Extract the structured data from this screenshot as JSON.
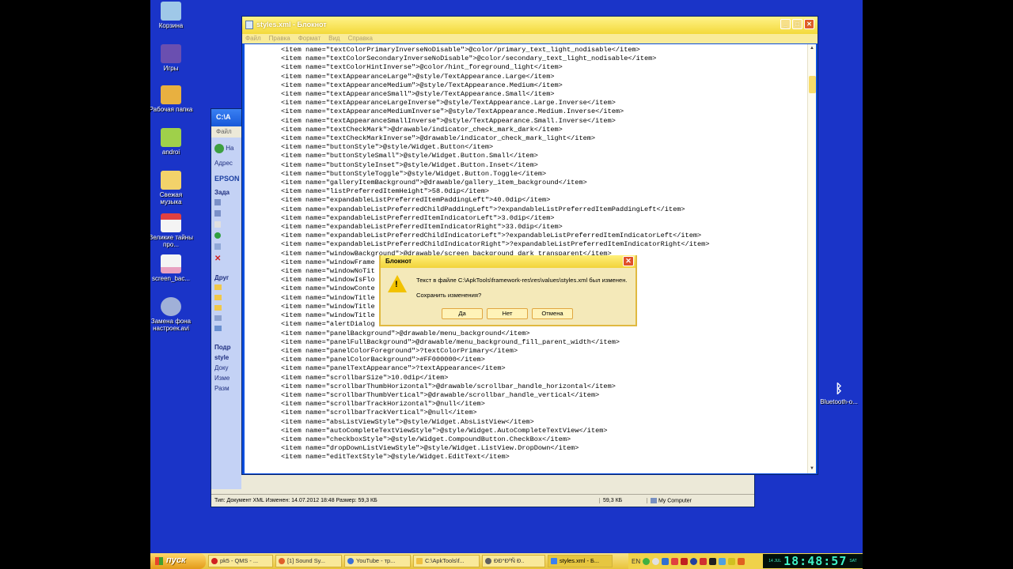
{
  "desktop": {
    "icons": [
      {
        "label": "Корзина",
        "icon": "recycle-bin-icon",
        "color": "#9fc8e8"
      },
      {
        "label": "Игры",
        "icon": "games-icon",
        "color": "#6a4fb0"
      },
      {
        "label": "Рабочая папка",
        "icon": "tools-folder-icon",
        "color": "#e8b040"
      },
      {
        "label": "androi",
        "icon": "android-icon",
        "color": "#9fd04a"
      },
      {
        "label": "Свежая музыка",
        "icon": "folder-icon",
        "color": "#f3d26a"
      },
      {
        "label": "Великие тайны про...",
        "icon": "pdf-icon",
        "color": "#e04040"
      },
      {
        "label": "screen_bac...",
        "icon": "image-file-icon",
        "color": "#e8a0c0"
      },
      {
        "label": "Замена фона настроек.avi",
        "icon": "video-file-icon",
        "color": "#a0b0d8"
      }
    ],
    "bluetooth_label": "Bluetooth-о..."
  },
  "explorer": {
    "title": "C:\\A",
    "menu": "Файл",
    "back_label": "На",
    "address_label": "Адрес",
    "folder_label": "EPSON",
    "tasks_head": "Зада",
    "other_head": "Друг",
    "details_head": "Подр",
    "details_name": "style",
    "details_type": "Доку",
    "details_changed": "Изме",
    "details_size": "Разм",
    "status_left": "Тип: Документ XML Изменен: 14.07.2012 18:48 Размер: 59,3 КБ",
    "status_size": "59,3 КБ",
    "status_location": "My Computer"
  },
  "notepad": {
    "title": "styles.xml - Блокнот",
    "menu": [
      "Файл",
      "Правка",
      "Формат",
      "Вид",
      "Справка"
    ],
    "lines": [
      "<item name=\"textColorPrimaryInverseNoDisable\">@color/primary_text_light_nodisable</item>",
      "<item name=\"textColorSecondaryInverseNoDisable\">@color/secondary_text_light_nodisable</item>",
      "<item name=\"textColorHintInverse\">@color/hint_foreground_light</item>",
      "<item name=\"textAppearanceLarge\">@style/TextAppearance.Large</item>",
      "<item name=\"textAppearanceMedium\">@style/TextAppearance.Medium</item>",
      "<item name=\"textAppearanceSmall\">@style/TextAppearance.Small</item>",
      "<item name=\"textAppearanceLargeInverse\">@style/TextAppearance.Large.Inverse</item>",
      "<item name=\"textAppearanceMediumInverse\">@style/TextAppearance.Medium.Inverse</item>",
      "<item name=\"textAppearanceSmallInverse\">@style/TextAppearance.Small.Inverse</item>",
      "<item name=\"textCheckMark\">@drawable/indicator_check_mark_dark</item>",
      "<item name=\"textCheckMarkInverse\">@drawable/indicator_check_mark_light</item>",
      "<item name=\"buttonStyle\">@style/Widget.Button</item>",
      "<item name=\"buttonStyleSmall\">@style/Widget.Button.Small</item>",
      "<item name=\"buttonStyleInset\">@style/Widget.Button.Inset</item>",
      "<item name=\"buttonStyleToggle\">@style/Widget.Button.Toggle</item>",
      "<item name=\"galleryItemBackground\">@drawable/gallery_item_background</item>",
      "<item name=\"listPreferredItemHeight\">58.0dip</item>",
      "<item name=\"expandableListPreferredItemPaddingLeft\">40.0dip</item>",
      "<item name=\"expandableListPreferredChildPaddingLeft\">?expandableListPreferredItemPaddingLeft</item>",
      "<item name=\"expandableListPreferredItemIndicatorLeft\">3.0dip</item>",
      "<item name=\"expandableListPreferredItemIndicatorRight\">33.0dip</item>",
      "<item name=\"expandableListPreferredChildIndicatorLeft\">?expandableListPreferredItemIndicatorLeft</item>",
      "<item name=\"expandableListPreferredChildIndicatorRight\">?expandableListPreferredItemIndicatorRight</item>",
      "<item name=\"windowBackground\">@drawable/screen_background_dark_transparent</item>",
      "<item name=\"windowFrame",
      "<item name=\"windowNoTit",
      "<item name=\"windowIsFlo",
      "<item name=\"windowConte",
      "<item name=\"windowTitle",
      "<item name=\"windowTitle",
      "<item name=\"windowTitle",
      "<item name=\"alertDialog",
      "<item name=\"panelBackground\">@drawable/menu_background</item>",
      "<item name=\"panelFullBackground\">@drawable/menu_background_fill_parent_width</item>",
      "<item name=\"panelColorForeground\">?textColorPrimary</item>",
      "<item name=\"panelColorBackground\">#FF000000</item>",
      "<item name=\"panelTextAppearance\">?textAppearance</item>",
      "<item name=\"scrollbarSize\">10.0dip</item>",
      "<item name=\"scrollbarThumbHorizontal\">@drawable/scrollbar_handle_horizontal</item>",
      "<item name=\"scrollbarThumbVertical\">@drawable/scrollbar_handle_vertical</item>",
      "<item name=\"scrollbarTrackHorizontal\">@null</item>",
      "<item name=\"scrollbarTrackVertical\">@null</item>",
      "<item name=\"absListViewStyle\">@style/Widget.AbsListView</item>",
      "<item name=\"autoCompleteTextViewStyle\">@style/Widget.AutoCompleteTextView</item>",
      "<item name=\"checkboxStyle\">@style/Widget.CompoundButton.CheckBox</item>",
      "<item name=\"dropDownListViewStyle\">@style/Widget.ListView.DropDown</item>",
      "<item name=\"editTextStyle\">@style/Widget.EditText</item>"
    ]
  },
  "dialog": {
    "title": "Блокнот",
    "message": "Текст в файле C:\\ApkTools\\framework-res\\res\\values\\styles.xml был изменен.",
    "question": "Сохранить изменения?",
    "yes": "Да",
    "no": "Нет",
    "cancel": "Отмена"
  },
  "taskbar": {
    "start": "пуск",
    "tasks": [
      {
        "label": "pk5 - QMS - ...",
        "color": "#d02020"
      },
      {
        "label": "[1] Sound Sy...",
        "color": "#e0602a"
      },
      {
        "label": "YouTube - тр...",
        "color": "#3a70d8"
      },
      {
        "label": "C:\\ApkTools\\f...",
        "color": "#f0c040"
      },
      {
        "label": "ÐÐ°ÐºÑ Ð..",
        "color": "#606060"
      },
      {
        "label": "styles.xml - Б...",
        "color": "#3a80f0",
        "active": true
      }
    ],
    "lang": "EN",
    "clock_time": "18:48:57",
    "clock_day": "SAT",
    "clock_date": "14 JUL"
  }
}
